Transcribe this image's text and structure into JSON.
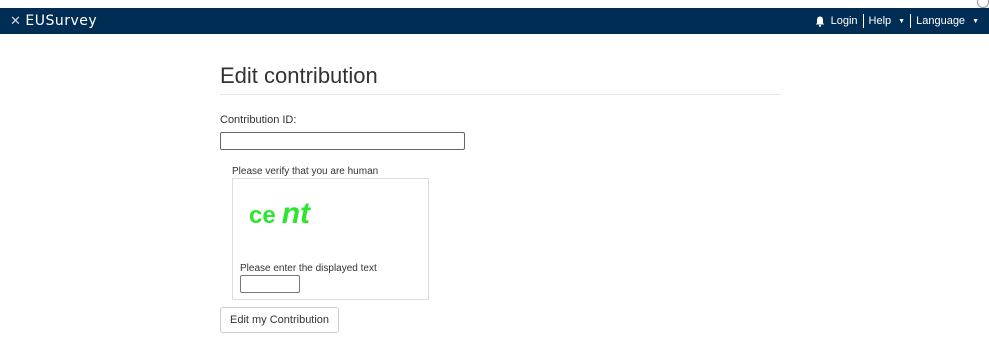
{
  "header": {
    "brand": "EUSurvey",
    "brand_logo_icon": "eusurvey-star-icon",
    "login": "Login",
    "help": "Help",
    "language": "Language"
  },
  "main": {
    "title": "Edit contribution",
    "contribution_id_label": "Contribution ID:",
    "contribution_id_value": "",
    "captcha": {
      "prompt": "Please verify that you are human",
      "word_part1": "ce",
      "word_part2": "nt",
      "enter_label": "Please enter the displayed text",
      "input_value": ""
    },
    "submit_label": "Edit my Contribution"
  },
  "colors": {
    "navbar": "#002d54",
    "captcha_text": "#2ee62e"
  }
}
